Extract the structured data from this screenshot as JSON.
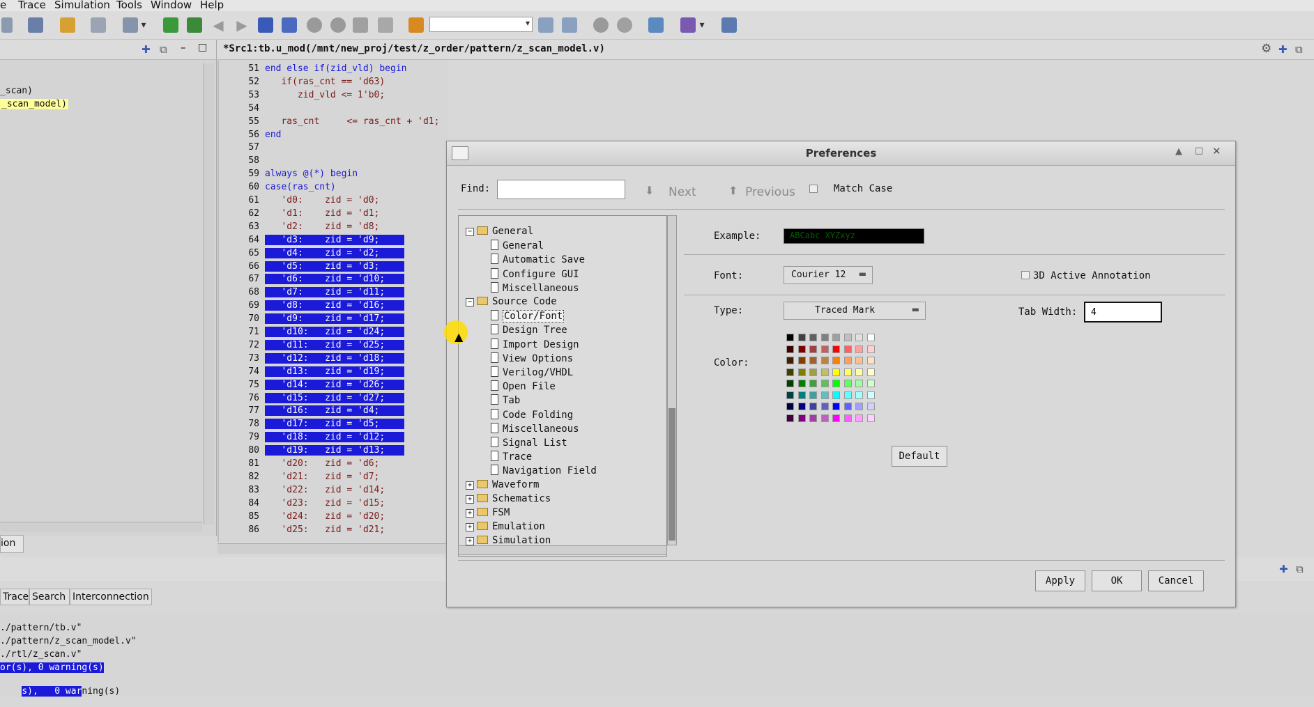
{
  "menu": {
    "items": [
      "e",
      "Trace",
      "Simulation",
      "Tools",
      "Window",
      "Help"
    ],
    "underline": [
      "",
      "T",
      "S",
      "T",
      "W",
      "H"
    ]
  },
  "editor": {
    "title": "*Src1:tb.u_mod(/mnt/new_proj/test/z_order/pattern/z_scan_model.v)",
    "lines": [
      {
        "n": "51",
        "t": "end else if(zid_vld) begin",
        "sel": false
      },
      {
        "n": "52",
        "t": "   if(ras_cnt == 'd63)",
        "sel": false
      },
      {
        "n": "53",
        "t": "      zid_vld <= 1'b0;",
        "sel": false
      },
      {
        "n": "54",
        "t": "",
        "sel": false
      },
      {
        "n": "55",
        "t": "   ras_cnt     <= ras_cnt + 'd1;",
        "sel": false
      },
      {
        "n": "56",
        "t": "end",
        "sel": false
      },
      {
        "n": "57",
        "t": "",
        "sel": false
      },
      {
        "n": "58",
        "t": "",
        "sel": false
      },
      {
        "n": "59",
        "t": "always @(*) begin",
        "sel": false
      },
      {
        "n": "60",
        "t": "case(ras_cnt)",
        "sel": false
      },
      {
        "n": "61",
        "t": "   'd0:    zid = 'd0;",
        "sel": false
      },
      {
        "n": "62",
        "t": "   'd1:    zid = 'd1;",
        "sel": false
      },
      {
        "n": "63",
        "t": "   'd2:    zid = 'd8;",
        "sel": false
      },
      {
        "n": "64",
        "t": "   'd3:    zid = 'd9;",
        "sel": true
      },
      {
        "n": "65",
        "t": "   'd4:    zid = 'd2;",
        "sel": true
      },
      {
        "n": "66",
        "t": "   'd5:    zid = 'd3;",
        "sel": true
      },
      {
        "n": "67",
        "t": "   'd6:    zid = 'd10;",
        "sel": true
      },
      {
        "n": "68",
        "t": "   'd7:    zid = 'd11;",
        "sel": true
      },
      {
        "n": "69",
        "t": "   'd8:    zid = 'd16;",
        "sel": true
      },
      {
        "n": "70",
        "t": "   'd9:    zid = 'd17;",
        "sel": true
      },
      {
        "n": "71",
        "t": "   'd10:   zid = 'd24;",
        "sel": true
      },
      {
        "n": "72",
        "t": "   'd11:   zid = 'd25;",
        "sel": true
      },
      {
        "n": "73",
        "t": "   'd12:   zid = 'd18;",
        "sel": true
      },
      {
        "n": "74",
        "t": "   'd13:   zid = 'd19;",
        "sel": true
      },
      {
        "n": "75",
        "t": "   'd14:   zid = 'd26;",
        "sel": true
      },
      {
        "n": "76",
        "t": "   'd15:   zid = 'd27;",
        "sel": true
      },
      {
        "n": "77",
        "t": "   'd16:   zid = 'd4;",
        "sel": true
      },
      {
        "n": "78",
        "t": "   'd17:   zid = 'd5;",
        "sel": true
      },
      {
        "n": "79",
        "t": "   'd18:   zid = 'd12;",
        "sel": true
      },
      {
        "n": "80",
        "t": "   'd19:   zid = 'd13;",
        "sel": true
      },
      {
        "n": "81",
        "t": "   'd20:   zid = 'd6;",
        "sel": false
      },
      {
        "n": "82",
        "t": "   'd21:   zid = 'd7;",
        "sel": false
      },
      {
        "n": "83",
        "t": "   'd22:   zid = 'd14;",
        "sel": false
      },
      {
        "n": "84",
        "t": "   'd23:   zid = 'd15;",
        "sel": false
      },
      {
        "n": "85",
        "t": "   'd24:   zid = 'd20;",
        "sel": false
      },
      {
        "n": "86",
        "t": "   'd25:   zid = 'd21;",
        "sel": false
      }
    ]
  },
  "left_pane": {
    "line1": "_scan)",
    "line2": "_scan_model)",
    "bottom_tab": "ion"
  },
  "bottom": {
    "tabs": [
      "Trace",
      "Search",
      "Interconnection"
    ],
    "console": [
      "./pattern/tb.v\"",
      "./pattern/z_scan_model.v\"",
      "./rtl/z_scan.v\"",
      "or(s), 0 warning(s)",
      "s),   0 warning(s)"
    ]
  },
  "dialog": {
    "title": "Preferences",
    "find_label": "Find:",
    "find_value": "",
    "next_label": "Next",
    "previous_label": "Previous",
    "match_case_label": "Match Case",
    "tree": {
      "general_group": "General",
      "general_items": [
        "General",
        "Automatic Save",
        "Configure GUI",
        "Miscellaneous"
      ],
      "source_group": "Source Code",
      "source_items": [
        "Color/Font",
        "Design Tree",
        "Import Design",
        "View Options",
        "Verilog/VHDL",
        "Open File",
        "Tab",
        "Code Folding",
        "Miscellaneous",
        "Signal List",
        "Trace",
        "Navigation Field"
      ],
      "collapsed_groups": [
        "Waveform",
        "Schematics",
        "FSM",
        "Emulation",
        "Simulation"
      ],
      "expand_minus": "−",
      "expand_plus": "+"
    },
    "example_label": "Example:",
    "example_text": "ABCabc XYZxyz",
    "font_label": "Font:",
    "font_value": "Courier 12",
    "active_annotation_label": "3D Active Annotation",
    "type_label": "Type:",
    "type_value": "Traced Mark",
    "tab_width_label": "Tab Width:",
    "tab_width_value": "4",
    "color_label": "Color:",
    "default_button": "Default",
    "apply_button": "Apply",
    "ok_button": "OK",
    "cancel_button": "Cancel",
    "palette": [
      [
        "#000000",
        "#404040",
        "#606060",
        "#808080",
        "#a0a0a0",
        "#c0c0c0",
        "#e0e0e0",
        "#ffffff"
      ],
      [
        "#400000",
        "#800000",
        "#a04040",
        "#c06060",
        "#ff0000",
        "#ff6060",
        "#ffa0a0",
        "#ffd0d0"
      ],
      [
        "#402000",
        "#804000",
        "#a06030",
        "#c08040",
        "#ff8000",
        "#ffa060",
        "#ffc090",
        "#ffe0c0"
      ],
      [
        "#404000",
        "#808000",
        "#a0a040",
        "#c0c060",
        "#ffff00",
        "#ffff60",
        "#ffffa0",
        "#ffffd0"
      ],
      [
        "#004000",
        "#008000",
        "#40a040",
        "#60c060",
        "#00ff00",
        "#60ff60",
        "#a0ffa0",
        "#d0ffd0"
      ],
      [
        "#004040",
        "#008080",
        "#40a0a0",
        "#60c0c0",
        "#00ffff",
        "#60ffff",
        "#a0ffff",
        "#d0ffff"
      ],
      [
        "#000040",
        "#000080",
        "#4040a0",
        "#6060c0",
        "#0000ff",
        "#6060ff",
        "#a0a0ff",
        "#d0d0ff"
      ],
      [
        "#400040",
        "#800080",
        "#a040a0",
        "#c060c0",
        "#ff00ff",
        "#ff60ff",
        "#ffa0ff",
        "#ffd0ff"
      ]
    ]
  },
  "colors": {
    "selection": "#1a1ad8",
    "keyword": "#1a1ad6",
    "example_bg": "#000000",
    "example_fg": "#006000"
  }
}
